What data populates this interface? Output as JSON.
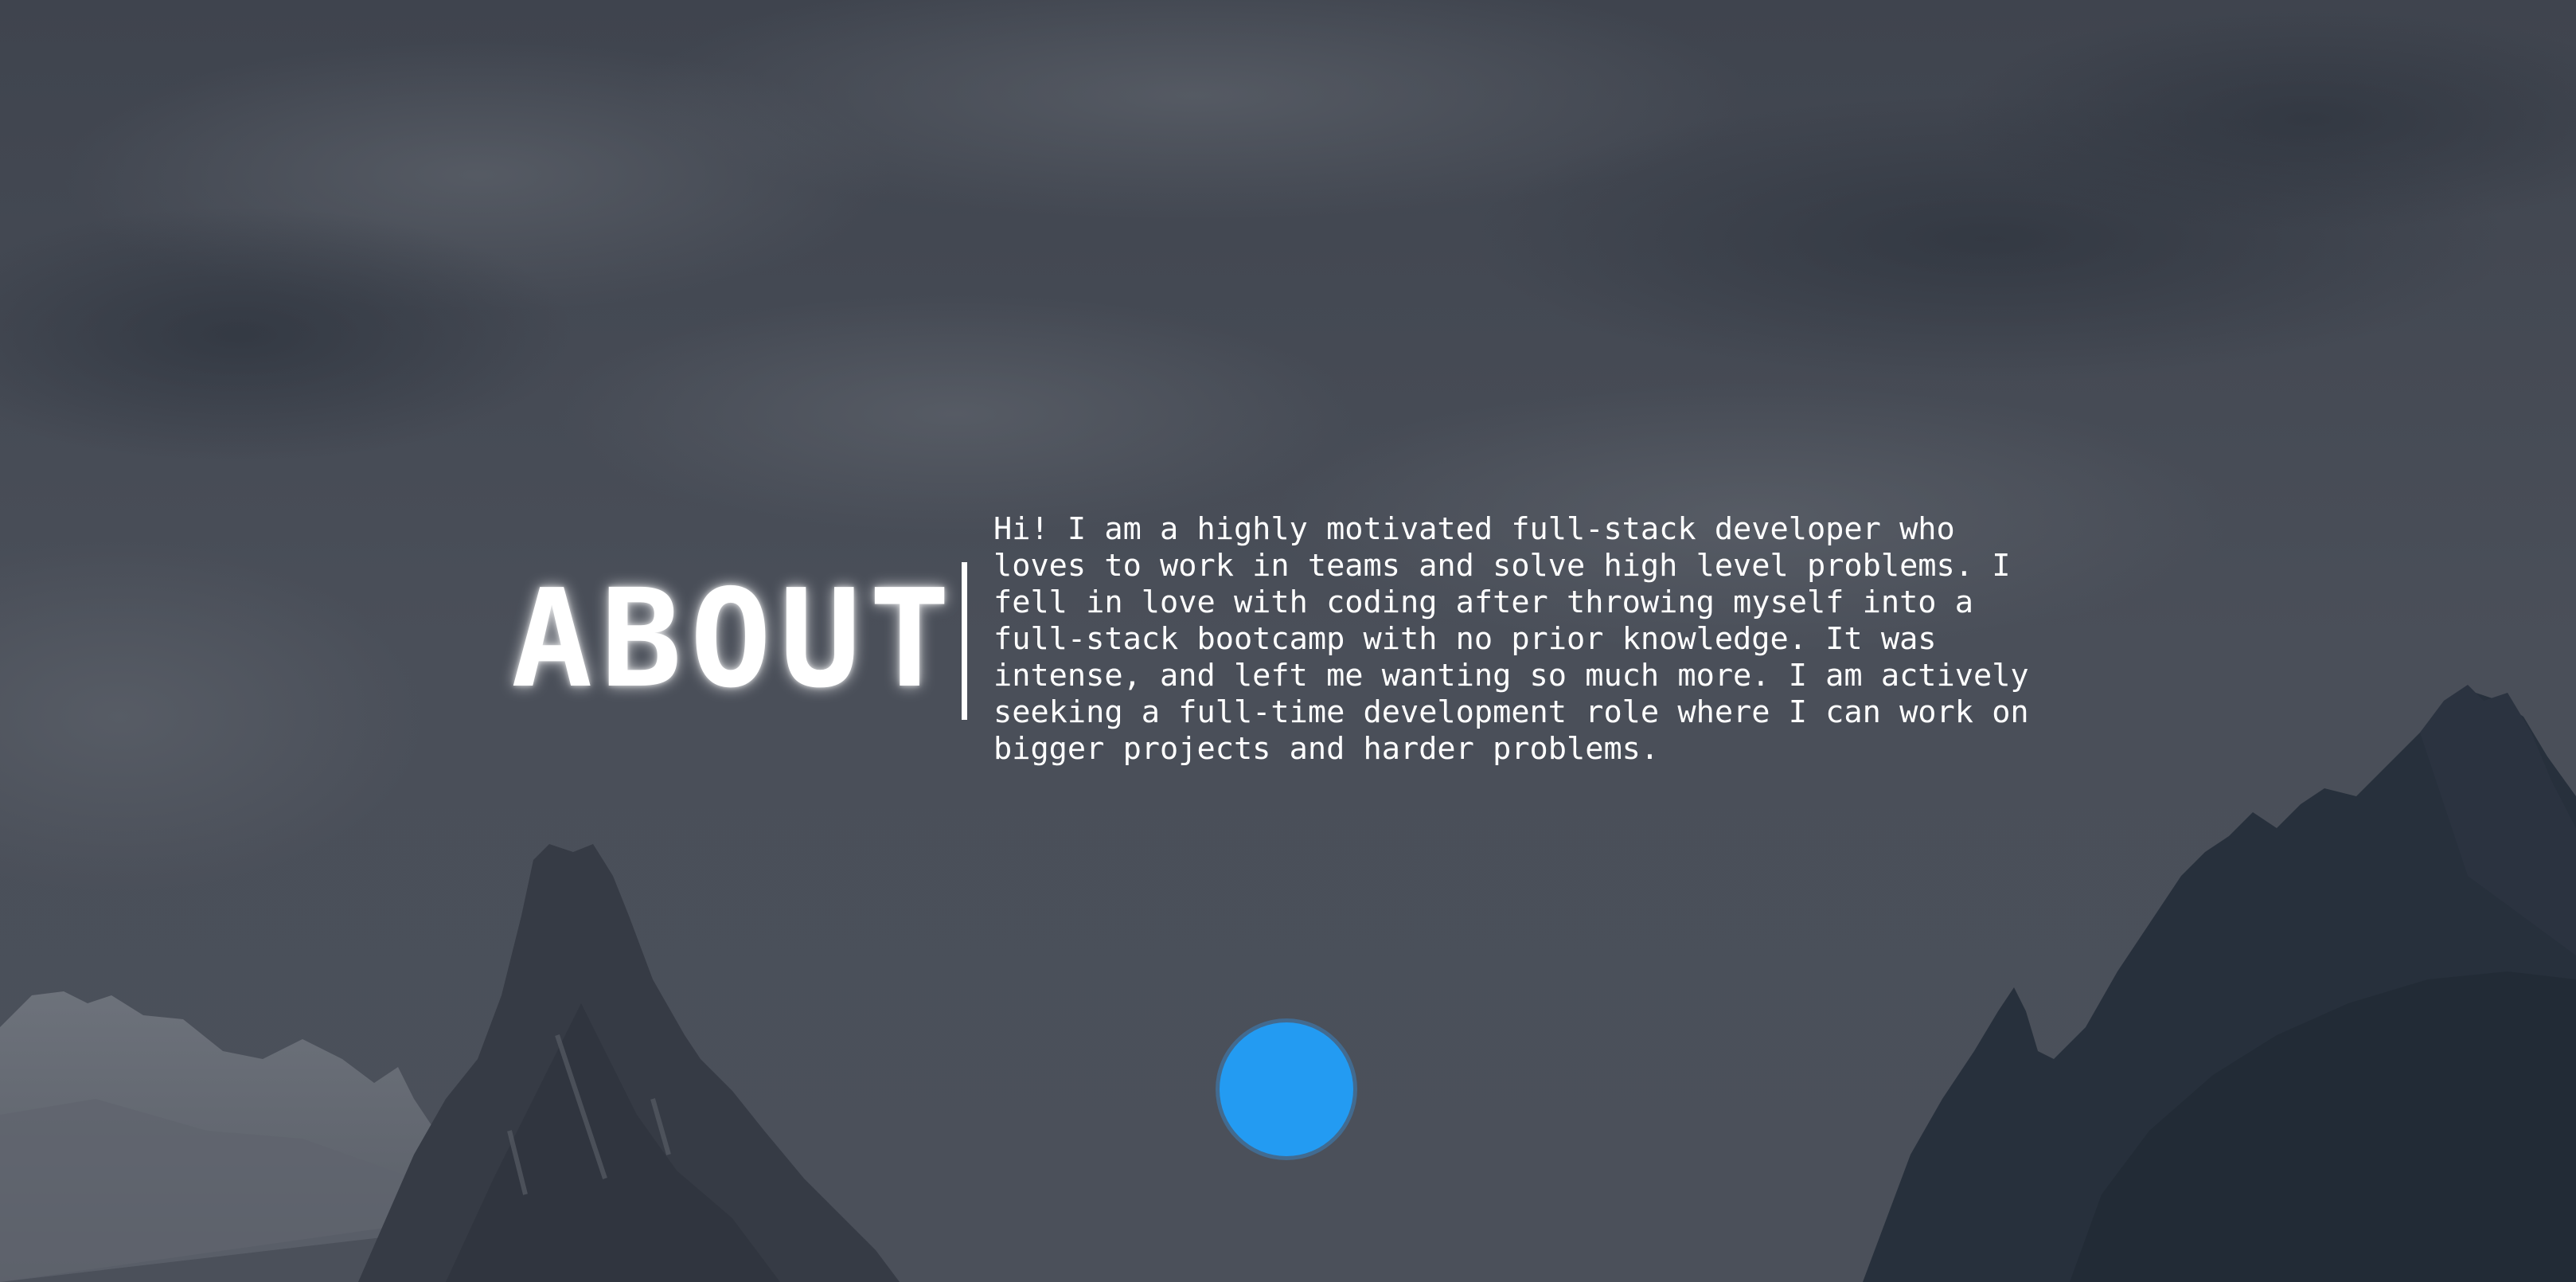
{
  "about": {
    "heading": "ABOUT",
    "paragraph": "Hi! I am a highly motivated full-stack developer who\nloves to work in teams and solve high level problems. I\nfell in love with coding after throwing myself into a\nfull-stack bootcamp with no prior knowledge. It was\nintense, and left me wanting so much more. I am actively\nseeking a full-time development role where I can work on\nbigger projects and harder problems."
  },
  "colors": {
    "overlay": "#474c56",
    "text": "#ffffff",
    "button": "#239bf2"
  }
}
